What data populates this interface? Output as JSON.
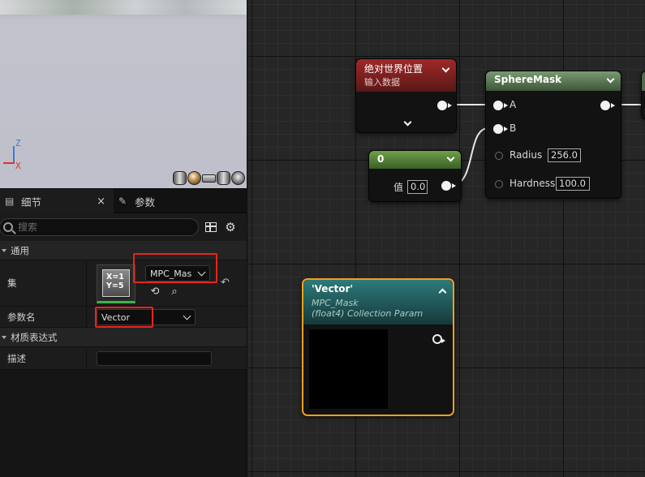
{
  "viewport": {
    "axis_z": "Z",
    "axis_x": "X",
    "preview_shapes": [
      "cylinder-icon",
      "sphere-icon",
      "plane-icon",
      "cube-icon",
      "teapot-icon"
    ]
  },
  "details": {
    "tabs": [
      {
        "label": "细节",
        "close": "×",
        "icon": "details-icon"
      },
      {
        "label": "参数",
        "icon": "pencil-icon"
      }
    ],
    "search_placeholder": "搜索",
    "sections": {
      "general": "通用",
      "material_expression": "材质表达式"
    },
    "rows": {
      "collection_label": "集",
      "collection_value": "MPC_Mask",
      "collection_thumb": "X=1\nY=5",
      "param_name_label": "参数名",
      "param_name_value": "Vector",
      "desc_label": "描述",
      "desc_value": ""
    }
  },
  "graph": {
    "world_position": {
      "title": "绝对世界位置",
      "subtitle": "输入数据"
    },
    "sphere_mask": {
      "title": "SphereMask",
      "pin_a": "A",
      "pin_b": "B",
      "radius_label": "Radius",
      "radius_value": "256.0",
      "hardness_label": "Hardness",
      "hardness_value": "100.0"
    },
    "constant": {
      "title": "0",
      "value_label": "值",
      "value": "0.0"
    },
    "collection_param": {
      "title": "'Vector'",
      "line1": "MPC_Mask",
      "line2": "(float4) Collection Param"
    },
    "colors": {
      "world_position_head": "#8c1f1f",
      "sphere_mask_head": "#5f7f55",
      "constant_head": "#5f8a3f",
      "collection_head": "#1f5a5a",
      "selection_outline": "#f0a020"
    }
  }
}
